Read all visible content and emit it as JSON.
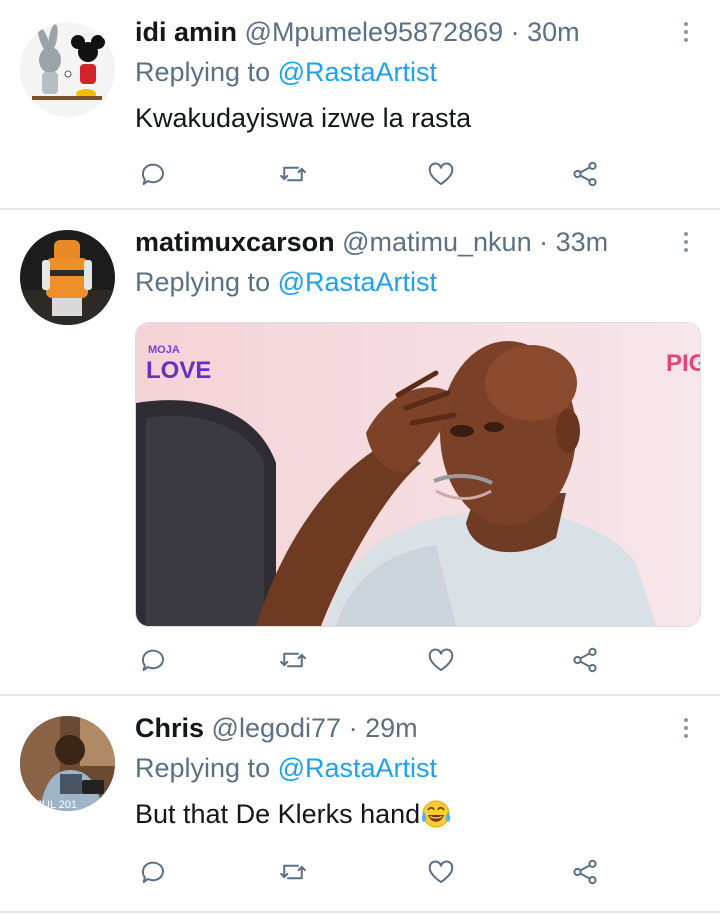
{
  "tweets": [
    {
      "display_name": "idi amin",
      "handle": "@Mpumele95872869",
      "separator": " · ",
      "time": "30m",
      "replying_prefix": "Replying to ",
      "replying_to": "@RastaArtist",
      "text": "Kwakudayiswa izwe la rasta"
    },
    {
      "display_name": "matimuxcarson",
      "handle": "@matimu_nkun",
      "separator": " · ",
      "time": "33m",
      "replying_prefix": "Replying to ",
      "replying_to": "@RastaArtist",
      "media": {
        "logo_top": "MOJA",
        "logo_bottom": "LOVE",
        "corner_text": "PIG"
      }
    },
    {
      "display_name": "Chris",
      "handle": "@legodi77",
      "separator": " · ",
      "time": "29m",
      "replying_prefix": "Replying to ",
      "replying_to": "@RastaArtist",
      "text": "But that De Klerks hand",
      "emoji": "face-with-tears-of-joy"
    }
  ],
  "avatar3_overlay_text": "S JUL 201",
  "colors": {
    "name": "#14171a",
    "meta": "#5b7083",
    "link": "#1da1f2",
    "icon": "#5b7083",
    "divider": "#e1e8ed"
  },
  "icons": [
    "reply-icon",
    "retweet-icon",
    "like-icon",
    "share-icon",
    "more-options-icon"
  ]
}
